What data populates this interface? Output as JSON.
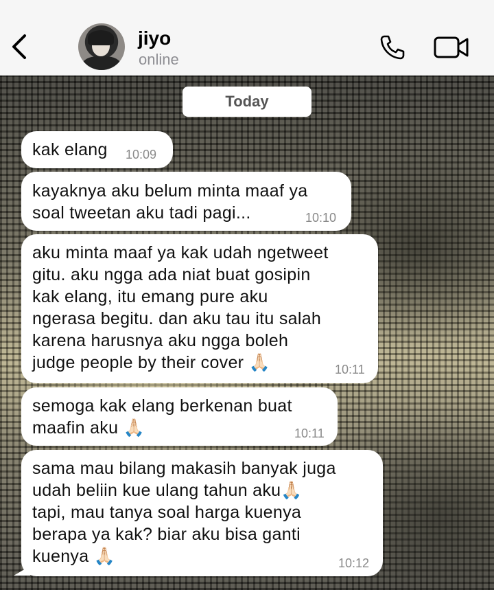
{
  "header": {
    "contact_name": "jiyo",
    "status": "online"
  },
  "chat": {
    "date_label": "Today",
    "messages": [
      {
        "text": "kak elang",
        "time": "10:09"
      },
      {
        "text": "kayaknya aku belum minta maaf ya\nsoal tweetan aku tadi pagi...",
        "time": "10:10"
      },
      {
        "text": "aku minta maaf ya kak udah ngetweet\ngitu. aku ngga ada niat buat gosipin\nkak elang, itu emang pure aku\nngerasa begitu. dan aku tau itu salah\nkarena harusnya aku ngga boleh\njudge people by their cover 🙏🏻",
        "time": "10:11"
      },
      {
        "text": "semoga kak elang berkenan buat\nmaafin aku 🙏🏻",
        "time": "10:11"
      },
      {
        "text": "sama mau bilang makasih banyak juga\nudah beliin kue ulang tahun aku🙏🏻\ntapi, mau tanya soal harga kuenya\nberapa ya kak? biar aku bisa ganti\nkuenya 🙏🏻",
        "time": "10:12"
      }
    ]
  },
  "icons": {
    "back": "chevron-left-icon",
    "call": "phone-icon",
    "video": "video-camera-icon"
  }
}
